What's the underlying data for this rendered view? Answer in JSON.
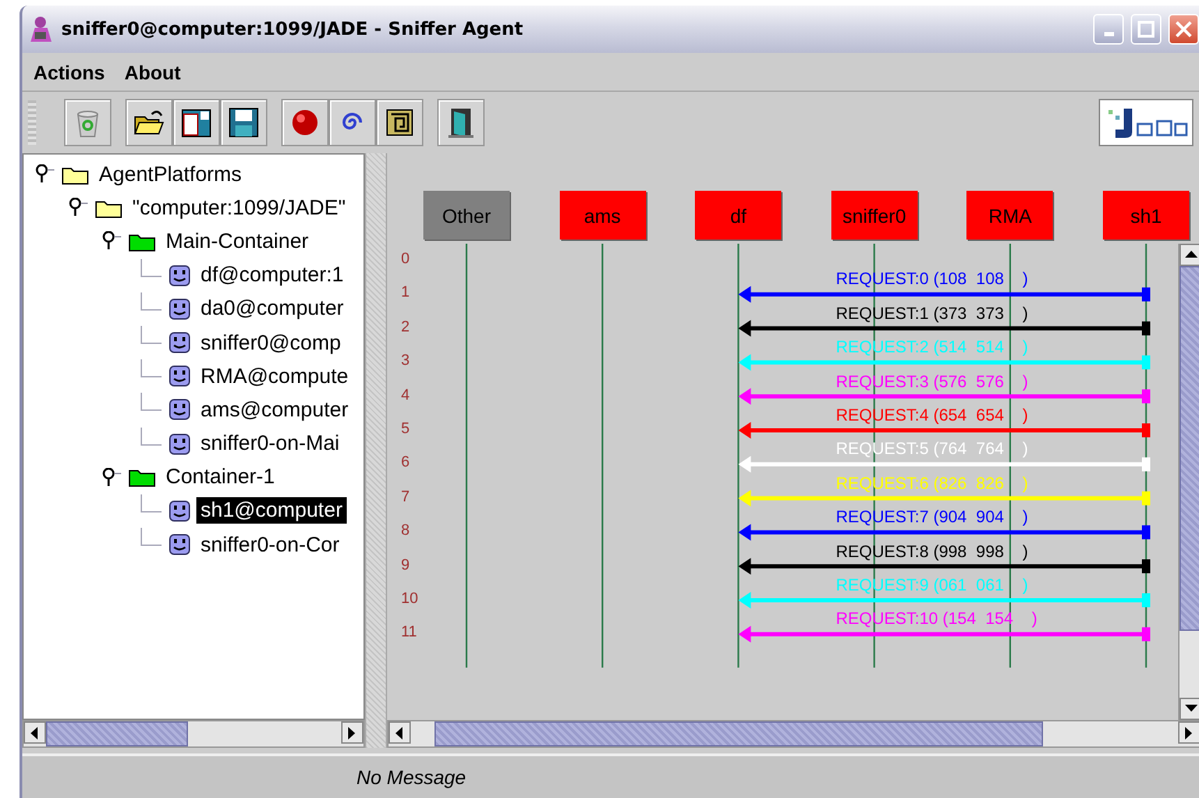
{
  "window": {
    "title": "sniffer0@computer:1099/JADE - Sniffer Agent"
  },
  "menu": [
    "Actions",
    "About"
  ],
  "tree": [
    {
      "label": "AgentPlatforms",
      "kind": "platform",
      "expanded": true,
      "selected": false,
      "children": [
        {
          "label": "\"computer:1099/JADE\"",
          "kind": "platform",
          "expanded": true,
          "selected": false,
          "children": [
            {
              "label": "Main-Container",
              "kind": "container",
              "expanded": true,
              "selected": false,
              "children": [
                {
                  "label": "df@computer:1",
                  "kind": "agent",
                  "selected": false
                },
                {
                  "label": "da0@computer",
                  "kind": "agent",
                  "selected": false
                },
                {
                  "label": "sniffer0@comp",
                  "kind": "agent",
                  "selected": false
                },
                {
                  "label": "RMA@compute",
                  "kind": "agent",
                  "selected": false
                },
                {
                  "label": "ams@computer",
                  "kind": "agent",
                  "selected": false
                },
                {
                  "label": "sniffer0-on-Mai",
                  "kind": "agent",
                  "selected": false
                }
              ]
            },
            {
              "label": "Container-1",
              "kind": "container",
              "expanded": true,
              "selected": false,
              "children": [
                {
                  "label": "sh1@computer",
                  "kind": "agent",
                  "selected": true
                },
                {
                  "label": "sniffer0-on-Cor",
                  "kind": "agent",
                  "selected": false
                }
              ]
            }
          ]
        }
      ]
    }
  ],
  "agents": [
    {
      "label": "Other",
      "color": "#808080"
    },
    {
      "label": "ams",
      "color": "#ff0000"
    },
    {
      "label": "df",
      "color": "#ff0000"
    },
    {
      "label": "sniffer0",
      "color": "#ff0000"
    },
    {
      "label": "RMA",
      "color": "#ff0000"
    },
    {
      "label": "sh1",
      "color": "#ff0000"
    }
  ],
  "rows": [
    "0",
    "1",
    "2",
    "3",
    "4",
    "5",
    "6",
    "7",
    "8",
    "9",
    "10",
    "11"
  ],
  "messages": [
    {
      "label": "REQUEST:0 (108  108    )",
      "color": "#0000ff"
    },
    {
      "label": "REQUEST:1 (373  373    )",
      "color": "#000000"
    },
    {
      "label": "REQUEST:2 (514  514    )",
      "color": "#00ffff"
    },
    {
      "label": "REQUEST:3 (576  576    )",
      "color": "#ff00ff"
    },
    {
      "label": "REQUEST:4 (654  654    )",
      "color": "#ff0000"
    },
    {
      "label": "REQUEST:5 (764  764    )",
      "color": "#ffffff"
    },
    {
      "label": "REQUEST:6 (826  826    )",
      "color": "#ffff00"
    },
    {
      "label": "REQUEST:7 (904  904    )",
      "color": "#0000ff"
    },
    {
      "label": "REQUEST:8 (998  998    )",
      "color": "#000000"
    },
    {
      "label": "REQUEST:9 (061  061    )",
      "color": "#00ffff"
    },
    {
      "label": "REQUEST:10 (154  154    )",
      "color": "#ff00ff"
    }
  ],
  "status_bar": {
    "message": "No Message"
  }
}
